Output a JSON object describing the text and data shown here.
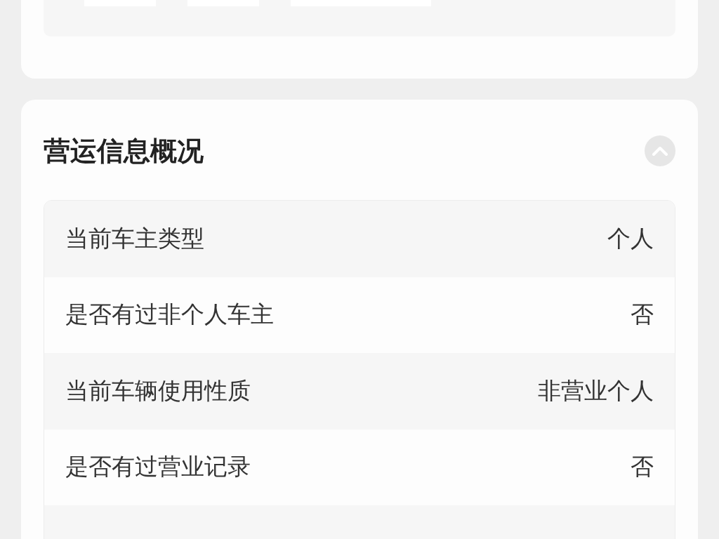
{
  "top_card": {
    "chips": [
      {
        "kind": "short"
      },
      {
        "kind": "short"
      },
      {
        "kind": "long"
      }
    ]
  },
  "section": {
    "title": "营运信息概况",
    "expanded": true,
    "rows": [
      {
        "label": "当前车主类型",
        "value": "个人"
      },
      {
        "label": "是否有过非个人车主",
        "value": "否"
      },
      {
        "label": "当前车辆使用性质",
        "value": "非营业个人"
      },
      {
        "label": "是否有过营业记录",
        "value": "否"
      }
    ]
  }
}
